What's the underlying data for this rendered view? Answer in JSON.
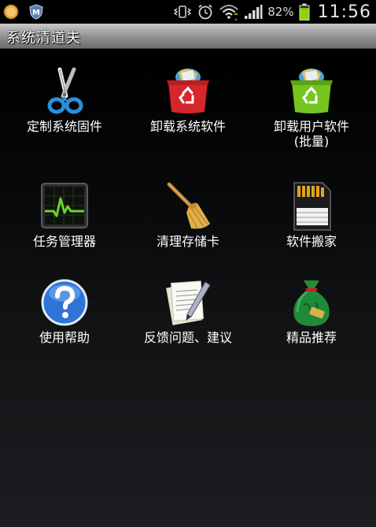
{
  "status_bar": {
    "left_icons": [
      "coin-icon",
      "shield-m-icon"
    ],
    "right_icons": [
      "vibrate-icon",
      "alarm-icon",
      "wifi-icon",
      "signal-icon"
    ],
    "battery_percent": "82%",
    "battery_level": 0.82,
    "time": "11:56"
  },
  "app": {
    "title": "系统清道夫"
  },
  "colors": {
    "title_bar_top": "#c9c9c9",
    "title_bar_bottom": "#6e6e6e",
    "battery_green": "#8fd400",
    "recycle_red": "#d6262b",
    "recycle_green": "#74c61f"
  },
  "menu": [
    {
      "id": "customize-firmware",
      "icon": "scissors-icon",
      "label": "定制系统固件"
    },
    {
      "id": "uninstall-system",
      "icon": "red-recycle-bin-icon",
      "label": "卸载系统软件"
    },
    {
      "id": "uninstall-user",
      "icon": "green-recycle-bin-icon",
      "label": "卸载用户软件(批量)"
    },
    {
      "id": "task-manager",
      "icon": "monitor-pulse-icon",
      "label": "任务管理器"
    },
    {
      "id": "clean-sdcard",
      "icon": "broom-icon",
      "label": "清理存储卡"
    },
    {
      "id": "move-apps",
      "icon": "sd-card-icon",
      "label": "软件搬家"
    },
    {
      "id": "help",
      "icon": "help-icon",
      "label": "使用帮助"
    },
    {
      "id": "feedback",
      "icon": "note-pen-icon",
      "label": "反馈问题、建议"
    },
    {
      "id": "recommended",
      "icon": "money-bag-icon",
      "label": "精品推荐"
    }
  ]
}
